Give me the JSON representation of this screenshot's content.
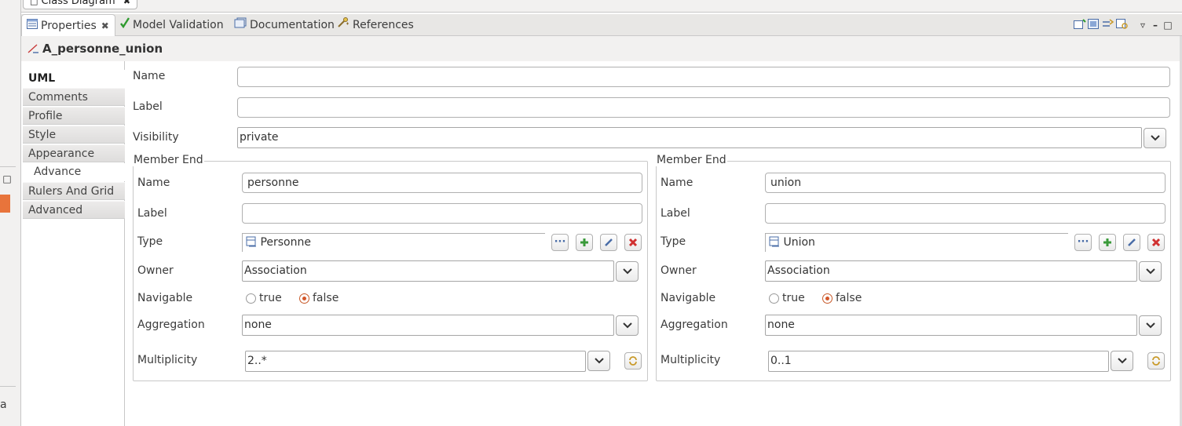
{
  "editor": {
    "tab_label": "Class Diagram"
  },
  "view_tabs": [
    {
      "label": "Properties",
      "active": true
    },
    {
      "label": "Model Validation"
    },
    {
      "label": "Documentation"
    },
    {
      "label": "References"
    }
  ],
  "header": {
    "title": "A_personne_union"
  },
  "sections": [
    {
      "label": "UML",
      "selected": true
    },
    {
      "label": "Comments"
    },
    {
      "label": "Profile"
    },
    {
      "label": "Style"
    },
    {
      "label": "Appearance"
    },
    {
      "label": "Advance"
    },
    {
      "label": "Rulers And Grid"
    },
    {
      "label": "Advanced"
    }
  ],
  "left_strip": {
    "fragment": "a"
  },
  "form": {
    "name": {
      "label": "Name",
      "value": ""
    },
    "label": {
      "label": "Label",
      "value": ""
    },
    "visibility": {
      "label": "Visibility",
      "value": "private"
    }
  },
  "member_ends": [
    {
      "group_title": "Member End",
      "name_label": "Name",
      "name_value": "personne",
      "label_label": "Label",
      "label_value": "",
      "type_label": "Type",
      "type_value": "Personne",
      "owner_label": "Owner",
      "owner_value": "Association",
      "navigable_label": "Navigable",
      "true_label": "true",
      "false_label": "false",
      "navigable": false,
      "aggregation_label": "Aggregation",
      "aggregation_value": "none",
      "multiplicity_label": "Multiplicity",
      "multiplicity_value": "2..*"
    },
    {
      "group_title": "Member End",
      "name_label": "Name",
      "name_value": "union",
      "label_label": "Label",
      "label_value": "",
      "type_label": "Type",
      "type_value": "Union",
      "owner_label": "Owner",
      "owner_value": "Association",
      "navigable_label": "Navigable",
      "true_label": "true",
      "false_label": "false",
      "navigable": false,
      "aggregation_label": "Aggregation",
      "aggregation_value": "none",
      "multiplicity_label": "Multiplicity",
      "multiplicity_value": "0..1"
    }
  ],
  "colors": {
    "accent": "#d4572a",
    "check": "#2f9a2f",
    "delete": "#d03030",
    "add": "#3a9a3a"
  }
}
